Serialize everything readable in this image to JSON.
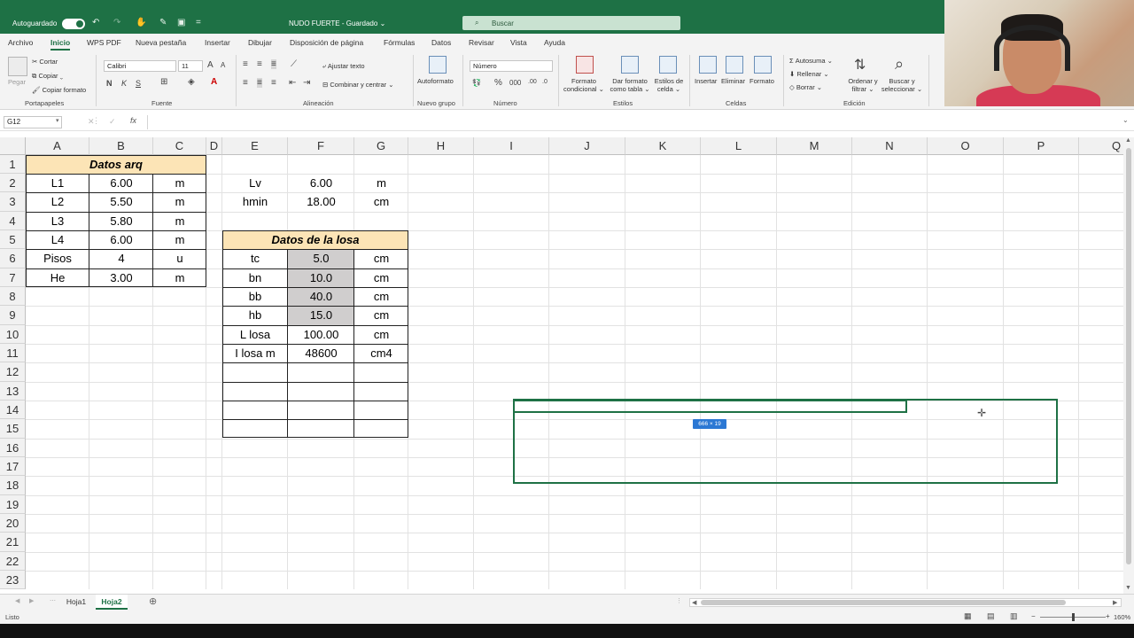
{
  "titlebar": {
    "autosave_label": "Autoguardado",
    "filename": "NUDO FUERTE",
    "saved_status": "Guardado",
    "search_placeholder": "Buscar"
  },
  "menu": [
    "Archivo",
    "Inicio",
    "WPS PDF",
    "Nueva pestaña",
    "Insertar",
    "Dibujar",
    "Disposición de página",
    "Fórmulas",
    "Datos",
    "Revisar",
    "Vista",
    "Ayuda"
  ],
  "ribbon": {
    "clipboard": {
      "paste": "Pegar",
      "cut": "Cortar",
      "copy": "Copiar",
      "format_painter": "Copiar formato",
      "group": "Portapapeles"
    },
    "font": {
      "name": "Calibri",
      "size": "11",
      "bold": "N",
      "italic": "K",
      "underline": "S",
      "group": "Fuente"
    },
    "alignment": {
      "wrap": "Ajustar texto",
      "merge": "Combinar y centrar",
      "group": "Alineación"
    },
    "new_group": {
      "autoformat": "Autoformato",
      "group": "Nuevo grupo"
    },
    "number": {
      "format": "Número",
      "group": "Número"
    },
    "styles": {
      "conditional": "Formato",
      "conditional2": "condicional",
      "as_table": "Dar formato",
      "as_table2": "como tabla",
      "cell_styles": "Estilos de",
      "cell_styles2": "celda",
      "group": "Estilos"
    },
    "cells": {
      "insert": "Insertar",
      "delete": "Eliminar",
      "format": "Formato",
      "group": "Celdas"
    },
    "editing": {
      "autosum": "Autosuma",
      "fill": "Rellenar",
      "clear": "Borrar",
      "sort": "Ordenar y",
      "sort2": "filtrar",
      "find": "Buscar y",
      "find2": "seleccionar",
      "group": "Edición"
    }
  },
  "formula_bar": {
    "name_box": "G12",
    "fx": "fx",
    "cancel": "✕",
    "enter": "✓",
    "value": ""
  },
  "columns": [
    "A",
    "B",
    "C",
    "D",
    "E",
    "F",
    "G",
    "H",
    "I",
    "J",
    "K",
    "L",
    "M",
    "N",
    "O",
    "P",
    "Q"
  ],
  "rows": [
    "1",
    "2",
    "3",
    "4",
    "5",
    "6",
    "7",
    "8",
    "9",
    "10",
    "11",
    "12",
    "13",
    "14",
    "15",
    "16",
    "17",
    "18",
    "19",
    "20",
    "21",
    "22",
    "23"
  ],
  "table_arq": {
    "title": "Datos arq",
    "rows": [
      [
        "L1",
        "6.00",
        "m"
      ],
      [
        "L2",
        "5.50",
        "m"
      ],
      [
        "L3",
        "5.80",
        "m"
      ],
      [
        "L4",
        "6.00",
        "m"
      ],
      [
        "Pisos",
        "4",
        "u"
      ],
      [
        "He",
        "3.00",
        "m"
      ]
    ]
  },
  "table_lv": {
    "rows": [
      [
        "Lv",
        "6.00",
        "m"
      ],
      [
        "hmin",
        "18.00",
        "cm"
      ]
    ]
  },
  "table_losa": {
    "title": "Datos de la losa",
    "rows": [
      [
        "tc",
        "5.0",
        "cm"
      ],
      [
        "bn",
        "10.0",
        "cm"
      ],
      [
        "bb",
        "40.0",
        "cm"
      ],
      [
        "hb",
        "15.0",
        "cm"
      ],
      [
        "L losa",
        "100.00",
        "cm"
      ],
      [
        "I losa m",
        "48600",
        "cm4"
      ],
      [
        "",
        "",
        ""
      ],
      [
        "",
        "",
        ""
      ],
      [
        "",
        "",
        ""
      ],
      [
        "",
        "",
        ""
      ]
    ]
  },
  "shape_tooltip": "666 × 19",
  "sheets": {
    "tabs": [
      "Hoja1",
      "Hoja2"
    ],
    "active": "Hoja2"
  },
  "status": {
    "ready": "Listo",
    "zoom": "160%"
  }
}
